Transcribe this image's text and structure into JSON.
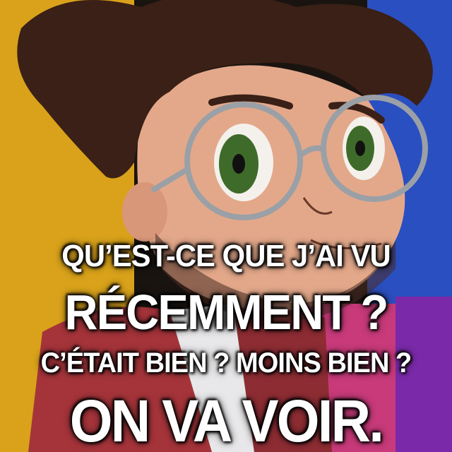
{
  "caption": {
    "line1": "QU’EST-CE QUE J’AI VU",
    "line2": "RÉCEMMENT ?",
    "line3": "C’ÉTAIT BIEN ? MOINS BIEN ?",
    "line4": "ON VA VOIR."
  },
  "colors": {
    "panel_yellow": "#d9a21a",
    "panel_blue": "#2a4fc0",
    "panel_green": "#1fa84a",
    "panel_pink": "#c83a7a",
    "hair": "#3a2016",
    "skin": "#e3a88a",
    "eyes": "#3f6b2a",
    "glasses": "#9aa0a6",
    "shirt": "#a5343a",
    "text": "#ffffff"
  }
}
